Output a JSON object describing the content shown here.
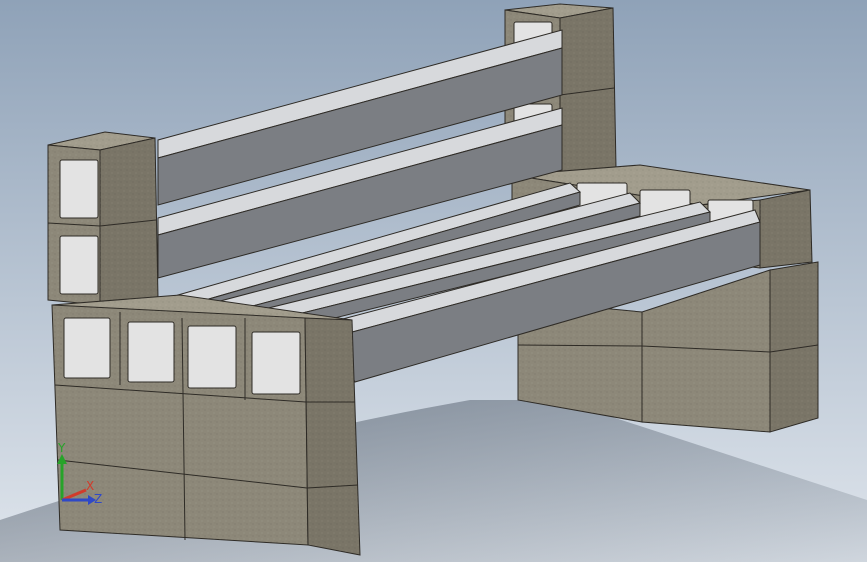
{
  "viewport": {
    "background_top": "#8fa2b8",
    "background_bottom": "#dfe5ec",
    "shadow_color": "#4a5563"
  },
  "materials": {
    "concrete_face": "#8d8879",
    "concrete_top": "#a29d8d",
    "concrete_side": "#7a7567",
    "concrete_hole": "#bdbdbd",
    "concrete_hole_inner": "#e3e3e3",
    "rail_top": "#d7d9dc",
    "rail_front": "#7b7e83",
    "edge_line": "#2e2b26"
  },
  "triad": {
    "y_label": "Y",
    "x_label": "X",
    "z_label": "Z",
    "y_color": "#27a32a",
    "x_color": "#d23b2b",
    "z_color": "#2f49c7"
  }
}
